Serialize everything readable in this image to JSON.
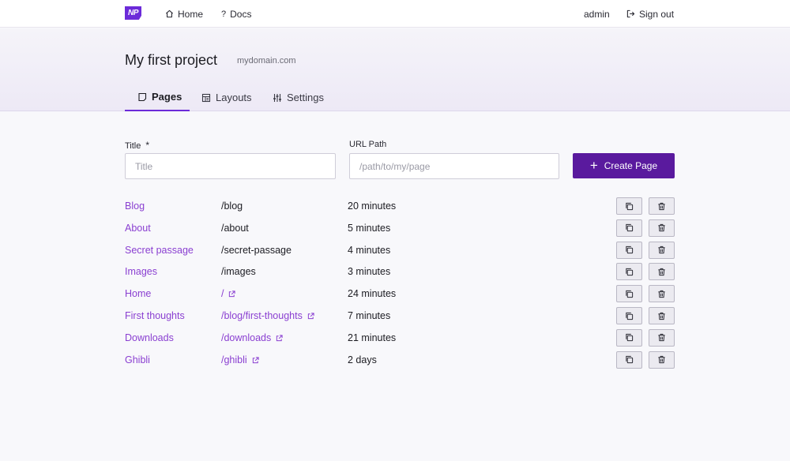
{
  "nav": {
    "logo_text": "NP",
    "home": "Home",
    "docs": "Docs",
    "user": "admin",
    "signout": "Sign out"
  },
  "project": {
    "title": "My first project",
    "domain": "mydomain.com"
  },
  "tabs": [
    {
      "label": "Pages",
      "icon": "page-icon",
      "active": true
    },
    {
      "label": "Layouts",
      "icon": "layout-icon",
      "active": false
    },
    {
      "label": "Settings",
      "icon": "sliders-icon",
      "active": false
    }
  ],
  "form": {
    "title_label": "Title",
    "required_mark": "*",
    "title_placeholder": "Title",
    "title_value": "",
    "url_label": "URL Path",
    "url_placeholder": "/path/to/my/page",
    "url_value": "",
    "create_label": "Create Page"
  },
  "pages": [
    {
      "title": "Blog",
      "path": "/blog",
      "time": "20 minutes",
      "linked": false
    },
    {
      "title": "About",
      "path": "/about",
      "time": "5 minutes",
      "linked": false
    },
    {
      "title": "Secret passage",
      "path": "/secret-passage",
      "time": "4 minutes",
      "linked": false
    },
    {
      "title": "Images",
      "path": "/images",
      "time": "3 minutes",
      "linked": false
    },
    {
      "title": "Home",
      "path": "/",
      "time": "24 minutes",
      "linked": true
    },
    {
      "title": "First thoughts",
      "path": "/blog/first-thoughts",
      "time": "7 minutes",
      "linked": true
    },
    {
      "title": "Downloads",
      "path": "/downloads",
      "time": "21 minutes",
      "linked": true
    },
    {
      "title": "Ghibli",
      "path": "/ghibli",
      "time": "2 days",
      "linked": true
    }
  ],
  "colors": {
    "accent": "#6c2bd9",
    "button": "#5a1a9e",
    "link": "#8a3fd1"
  }
}
